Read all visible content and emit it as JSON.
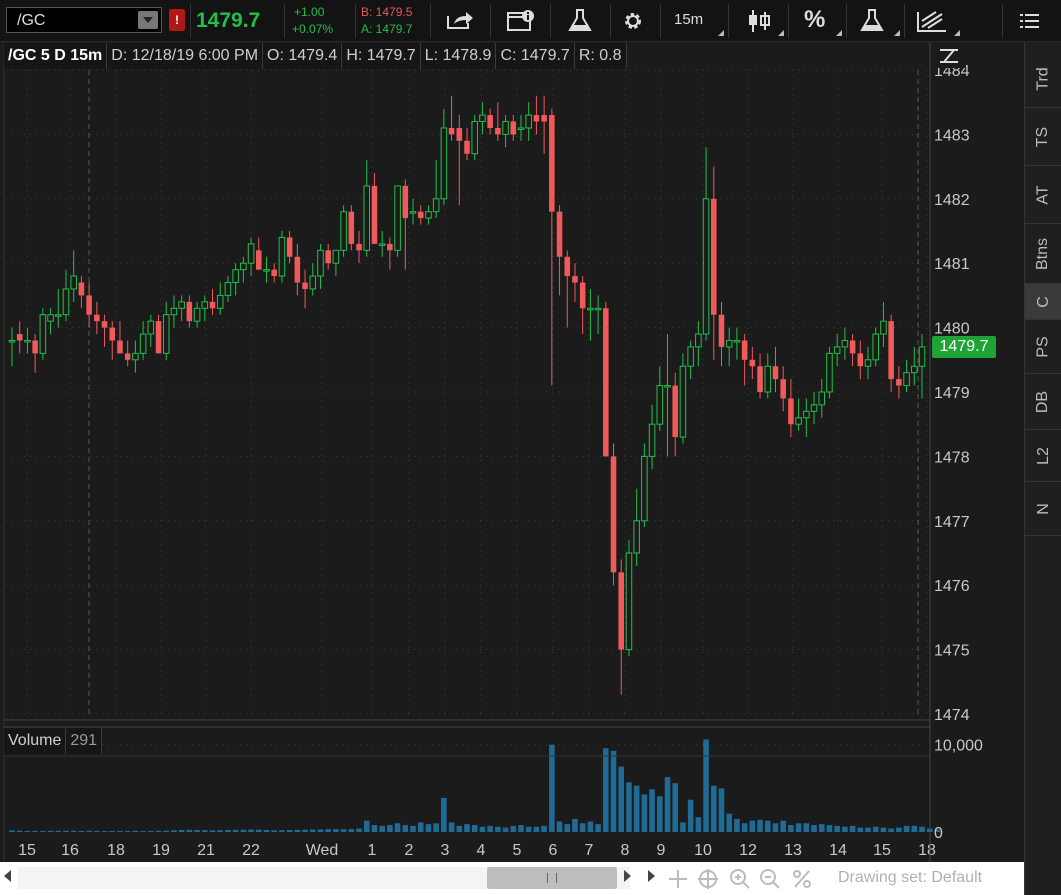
{
  "toolbar": {
    "symbol": "/GC",
    "alert_flag": "!",
    "last_price": "1479.7",
    "change_abs": "+1.00",
    "change_pct": "+0.07%",
    "bid": "B: 1479.5",
    "ask": "A: 1479.7",
    "interval": "15m",
    "percent": "%",
    "menu_icon": "hamburger-menu-icon"
  },
  "chart_header": {
    "title": "/GC 5 D 15m",
    "date": "D: 12/18/19 6:00 PM",
    "open": "O: 1479.4",
    "high": "H: 1479.7",
    "low": "L: 1478.9",
    "close": "C: 1479.7",
    "range": "R: 0.8"
  },
  "volume_header": {
    "label": "Volume",
    "value": "291"
  },
  "price_tag": "1479.7",
  "right_tabs": [
    "Trd",
    "TS",
    "AT",
    "Btns",
    "C",
    "PS",
    "DB",
    "L2",
    "N"
  ],
  "active_tab": "C",
  "bottom_bar": {
    "drawing_set": "Drawing set: Default"
  },
  "colors": {
    "up": "#21c04a",
    "down": "#f05a5a",
    "volume": "#1f6b95",
    "background": "#1b1b1b",
    "grid": "#3c3c3c"
  },
  "chart_data": {
    "type": "candlestick",
    "title": "/GC 5 D 15m",
    "ylim": [
      1474,
      1484
    ],
    "y_ticks": [
      "1484",
      "1483",
      "1482",
      "1481",
      "1480",
      "1479",
      "1478",
      "1477",
      "1476",
      "1475",
      "1474"
    ],
    "x_ticks": [
      "15",
      "16",
      "18",
      "19",
      "21",
      "22",
      "Wed",
      "1",
      "2",
      "3",
      "4",
      "5",
      "6",
      "7",
      "8",
      "9",
      "10",
      "12",
      "13",
      "14",
      "15",
      "18"
    ],
    "volume_ticks": [
      "10,000",
      "0"
    ],
    "volume_ylim": [
      0,
      11000
    ],
    "candles": [
      {
        "o": 1479.8,
        "h": 1480.0,
        "l": 1479.4,
        "c": 1479.8
      },
      {
        "o": 1479.9,
        "h": 1480.1,
        "l": 1479.6,
        "c": 1479.8
      },
      {
        "o": 1479.8,
        "h": 1480.0,
        "l": 1479.6,
        "c": 1479.8
      },
      {
        "o": 1479.8,
        "h": 1479.9,
        "l": 1479.3,
        "c": 1479.6
      },
      {
        "o": 1479.6,
        "h": 1480.3,
        "l": 1479.5,
        "c": 1480.2
      },
      {
        "o": 1480.1,
        "h": 1480.3,
        "l": 1479.9,
        "c": 1480.2
      },
      {
        "o": 1480.2,
        "h": 1480.6,
        "l": 1480.0,
        "c": 1480.2
      },
      {
        "o": 1480.2,
        "h": 1480.9,
        "l": 1480.1,
        "c": 1480.6
      },
      {
        "o": 1480.6,
        "h": 1481.2,
        "l": 1480.4,
        "c": 1480.8
      },
      {
        "o": 1480.7,
        "h": 1480.8,
        "l": 1480.3,
        "c": 1480.5
      },
      {
        "o": 1480.5,
        "h": 1480.7,
        "l": 1480.0,
        "c": 1480.2
      },
      {
        "o": 1480.2,
        "h": 1480.4,
        "l": 1479.9,
        "c": 1480.1
      },
      {
        "o": 1480.1,
        "h": 1480.2,
        "l": 1479.7,
        "c": 1480.0
      },
      {
        "o": 1480.0,
        "h": 1480.1,
        "l": 1479.5,
        "c": 1479.8
      },
      {
        "o": 1479.8,
        "h": 1480.1,
        "l": 1479.6,
        "c": 1479.6
      },
      {
        "o": 1479.6,
        "h": 1479.8,
        "l": 1479.4,
        "c": 1479.5
      },
      {
        "o": 1479.5,
        "h": 1479.8,
        "l": 1479.3,
        "c": 1479.6
      },
      {
        "o": 1479.6,
        "h": 1480.1,
        "l": 1479.5,
        "c": 1479.9
      },
      {
        "o": 1479.9,
        "h": 1480.2,
        "l": 1479.7,
        "c": 1480.1
      },
      {
        "o": 1480.1,
        "h": 1480.2,
        "l": 1479.6,
        "c": 1479.6
      },
      {
        "o": 1479.6,
        "h": 1480.4,
        "l": 1479.5,
        "c": 1480.2
      },
      {
        "o": 1480.2,
        "h": 1480.5,
        "l": 1480.0,
        "c": 1480.3
      },
      {
        "o": 1480.3,
        "h": 1480.5,
        "l": 1480.1,
        "c": 1480.4
      },
      {
        "o": 1480.4,
        "h": 1480.5,
        "l": 1480.0,
        "c": 1480.1
      },
      {
        "o": 1480.1,
        "h": 1480.4,
        "l": 1480.0,
        "c": 1480.3
      },
      {
        "o": 1480.3,
        "h": 1480.5,
        "l": 1480.1,
        "c": 1480.4
      },
      {
        "o": 1480.4,
        "h": 1480.6,
        "l": 1480.2,
        "c": 1480.3
      },
      {
        "o": 1480.3,
        "h": 1480.7,
        "l": 1480.2,
        "c": 1480.5
      },
      {
        "o": 1480.5,
        "h": 1480.8,
        "l": 1480.4,
        "c": 1480.7
      },
      {
        "o": 1480.7,
        "h": 1481.0,
        "l": 1480.5,
        "c": 1480.9
      },
      {
        "o": 1480.9,
        "h": 1481.1,
        "l": 1480.7,
        "c": 1481.0
      },
      {
        "o": 1481.0,
        "h": 1481.4,
        "l": 1480.8,
        "c": 1481.3
      },
      {
        "o": 1481.2,
        "h": 1481.4,
        "l": 1480.9,
        "c": 1480.9
      },
      {
        "o": 1480.9,
        "h": 1481.1,
        "l": 1480.7,
        "c": 1480.9
      },
      {
        "o": 1480.9,
        "h": 1481.0,
        "l": 1480.7,
        "c": 1480.8
      },
      {
        "o": 1480.8,
        "h": 1481.5,
        "l": 1480.7,
        "c": 1481.4
      },
      {
        "o": 1481.4,
        "h": 1481.5,
        "l": 1481.0,
        "c": 1481.1
      },
      {
        "o": 1481.1,
        "h": 1481.3,
        "l": 1480.5,
        "c": 1480.7
      },
      {
        "o": 1480.7,
        "h": 1480.9,
        "l": 1480.3,
        "c": 1480.6
      },
      {
        "o": 1480.6,
        "h": 1481.0,
        "l": 1480.5,
        "c": 1480.8
      },
      {
        "o": 1480.8,
        "h": 1481.3,
        "l": 1480.6,
        "c": 1481.2
      },
      {
        "o": 1481.2,
        "h": 1481.3,
        "l": 1480.9,
        "c": 1481.0
      },
      {
        "o": 1481.0,
        "h": 1481.2,
        "l": 1480.8,
        "c": 1481.2
      },
      {
        "o": 1481.2,
        "h": 1481.9,
        "l": 1481.1,
        "c": 1481.8
      },
      {
        "o": 1481.8,
        "h": 1481.9,
        "l": 1481.2,
        "c": 1481.3
      },
      {
        "o": 1481.3,
        "h": 1481.5,
        "l": 1481.0,
        "c": 1481.2
      },
      {
        "o": 1481.2,
        "h": 1482.6,
        "l": 1481.1,
        "c": 1482.2
      },
      {
        "o": 1482.2,
        "h": 1482.4,
        "l": 1481.3,
        "c": 1481.3
      },
      {
        "o": 1481.3,
        "h": 1481.5,
        "l": 1481.1,
        "c": 1481.3
      },
      {
        "o": 1481.3,
        "h": 1481.4,
        "l": 1480.9,
        "c": 1481.2
      },
      {
        "o": 1481.2,
        "h": 1482.2,
        "l": 1481.1,
        "c": 1482.2
      },
      {
        "o": 1482.2,
        "h": 1482.3,
        "l": 1480.9,
        "c": 1481.7
      },
      {
        "o": 1481.8,
        "h": 1482.0,
        "l": 1481.6,
        "c": 1481.8
      },
      {
        "o": 1481.8,
        "h": 1481.9,
        "l": 1481.6,
        "c": 1481.7
      },
      {
        "o": 1481.7,
        "h": 1481.9,
        "l": 1481.6,
        "c": 1481.8
      },
      {
        "o": 1481.8,
        "h": 1482.6,
        "l": 1481.7,
        "c": 1482.0
      },
      {
        "o": 1482.0,
        "h": 1483.4,
        "l": 1481.9,
        "c": 1483.1
      },
      {
        "o": 1483.1,
        "h": 1483.6,
        "l": 1482.9,
        "c": 1483.0
      },
      {
        "o": 1483.1,
        "h": 1483.3,
        "l": 1481.9,
        "c": 1482.9
      },
      {
        "o": 1482.9,
        "h": 1483.1,
        "l": 1482.6,
        "c": 1482.7
      },
      {
        "o": 1482.7,
        "h": 1483.3,
        "l": 1482.6,
        "c": 1483.2
      },
      {
        "o": 1483.2,
        "h": 1483.5,
        "l": 1483.0,
        "c": 1483.3
      },
      {
        "o": 1483.3,
        "h": 1483.4,
        "l": 1483.0,
        "c": 1483.1
      },
      {
        "o": 1483.1,
        "h": 1483.5,
        "l": 1482.9,
        "c": 1483.0
      },
      {
        "o": 1483.0,
        "h": 1483.3,
        "l": 1482.8,
        "c": 1483.2
      },
      {
        "o": 1483.2,
        "h": 1483.3,
        "l": 1482.9,
        "c": 1483.0
      },
      {
        "o": 1483.1,
        "h": 1483.3,
        "l": 1482.9,
        "c": 1483.1
      },
      {
        "o": 1483.1,
        "h": 1483.5,
        "l": 1482.9,
        "c": 1483.3
      },
      {
        "o": 1483.3,
        "h": 1483.6,
        "l": 1483.0,
        "c": 1483.2
      },
      {
        "o": 1483.3,
        "h": 1483.6,
        "l": 1482.7,
        "c": 1483.2
      },
      {
        "o": 1483.3,
        "h": 1483.4,
        "l": 1479.1,
        "c": 1481.8
      },
      {
        "o": 1481.8,
        "h": 1481.9,
        "l": 1480.5,
        "c": 1481.1
      },
      {
        "o": 1481.1,
        "h": 1481.2,
        "l": 1480.0,
        "c": 1480.8
      },
      {
        "o": 1480.8,
        "h": 1481.0,
        "l": 1480.4,
        "c": 1480.7
      },
      {
        "o": 1480.7,
        "h": 1480.8,
        "l": 1479.9,
        "c": 1480.3
      },
      {
        "o": 1480.3,
        "h": 1480.6,
        "l": 1479.8,
        "c": 1480.3
      },
      {
        "o": 1480.3,
        "h": 1480.5,
        "l": 1479.9,
        "c": 1480.3
      },
      {
        "o": 1480.3,
        "h": 1480.4,
        "l": 1478.0,
        "c": 1478.0
      },
      {
        "o": 1478.0,
        "h": 1478.2,
        "l": 1476.0,
        "c": 1476.2
      },
      {
        "o": 1476.2,
        "h": 1476.4,
        "l": 1474.3,
        "c": 1475.0
      },
      {
        "o": 1475.0,
        "h": 1476.7,
        "l": 1474.9,
        "c": 1476.5
      },
      {
        "o": 1476.5,
        "h": 1477.5,
        "l": 1476.3,
        "c": 1477.0
      },
      {
        "o": 1477.0,
        "h": 1478.2,
        "l": 1476.9,
        "c": 1478.0
      },
      {
        "o": 1478.0,
        "h": 1478.8,
        "l": 1477.8,
        "c": 1478.5
      },
      {
        "o": 1478.5,
        "h": 1479.4,
        "l": 1478.4,
        "c": 1479.1
      },
      {
        "o": 1479.1,
        "h": 1479.9,
        "l": 1478.0,
        "c": 1479.1
      },
      {
        "o": 1479.1,
        "h": 1479.3,
        "l": 1478.0,
        "c": 1478.3
      },
      {
        "o": 1478.3,
        "h": 1479.6,
        "l": 1478.2,
        "c": 1479.4
      },
      {
        "o": 1479.4,
        "h": 1479.8,
        "l": 1479.2,
        "c": 1479.7
      },
      {
        "o": 1479.7,
        "h": 1480.1,
        "l": 1479.4,
        "c": 1479.9
      },
      {
        "o": 1479.9,
        "h": 1482.8,
        "l": 1479.8,
        "c": 1482.0
      },
      {
        "o": 1482.0,
        "h": 1482.5,
        "l": 1479.5,
        "c": 1480.2
      },
      {
        "o": 1480.2,
        "h": 1480.4,
        "l": 1479.4,
        "c": 1479.7
      },
      {
        "o": 1479.7,
        "h": 1480.0,
        "l": 1479.4,
        "c": 1479.8
      },
      {
        "o": 1479.8,
        "h": 1480.0,
        "l": 1479.5,
        "c": 1479.8
      },
      {
        "o": 1479.8,
        "h": 1479.9,
        "l": 1479.1,
        "c": 1479.5
      },
      {
        "o": 1479.5,
        "h": 1479.7,
        "l": 1479.2,
        "c": 1479.4
      },
      {
        "o": 1479.4,
        "h": 1479.6,
        "l": 1478.9,
        "c": 1479.0
      },
      {
        "o": 1479.0,
        "h": 1479.6,
        "l": 1478.9,
        "c": 1479.4
      },
      {
        "o": 1479.4,
        "h": 1479.7,
        "l": 1479.0,
        "c": 1479.2
      },
      {
        "o": 1479.2,
        "h": 1479.4,
        "l": 1478.7,
        "c": 1478.9
      },
      {
        "o": 1478.9,
        "h": 1479.2,
        "l": 1478.3,
        "c": 1478.5
      },
      {
        "o": 1478.5,
        "h": 1478.9,
        "l": 1478.4,
        "c": 1478.6
      },
      {
        "o": 1478.6,
        "h": 1478.9,
        "l": 1478.3,
        "c": 1478.7
      },
      {
        "o": 1478.7,
        "h": 1479.0,
        "l": 1478.5,
        "c": 1478.8
      },
      {
        "o": 1478.8,
        "h": 1479.2,
        "l": 1478.6,
        "c": 1479.0
      },
      {
        "o": 1479.0,
        "h": 1479.7,
        "l": 1478.9,
        "c": 1479.6
      },
      {
        "o": 1479.6,
        "h": 1479.9,
        "l": 1479.4,
        "c": 1479.7
      },
      {
        "o": 1479.7,
        "h": 1480.0,
        "l": 1479.5,
        "c": 1479.8
      },
      {
        "o": 1479.8,
        "h": 1479.9,
        "l": 1479.4,
        "c": 1479.6
      },
      {
        "o": 1479.6,
        "h": 1479.8,
        "l": 1479.2,
        "c": 1479.4
      },
      {
        "o": 1479.4,
        "h": 1479.7,
        "l": 1479.2,
        "c": 1479.5
      },
      {
        "o": 1479.5,
        "h": 1480.0,
        "l": 1479.4,
        "c": 1479.9
      },
      {
        "o": 1479.9,
        "h": 1480.4,
        "l": 1479.7,
        "c": 1480.1
      },
      {
        "o": 1480.1,
        "h": 1480.2,
        "l": 1479.0,
        "c": 1479.2
      },
      {
        "o": 1479.2,
        "h": 1479.4,
        "l": 1478.9,
        "c": 1479.1
      },
      {
        "o": 1479.1,
        "h": 1479.5,
        "l": 1479.0,
        "c": 1479.3
      },
      {
        "o": 1479.3,
        "h": 1479.7,
        "l": 1479.1,
        "c": 1479.4
      },
      {
        "o": 1479.4,
        "h": 1479.9,
        "l": 1478.9,
        "c": 1479.7
      }
    ],
    "volume": [
      200,
      150,
      120,
      130,
      110,
      130,
      140,
      150,
      150,
      120,
      140,
      120,
      110,
      120,
      110,
      120,
      130,
      110,
      120,
      140,
      160,
      200,
      230,
      250,
      220,
      210,
      200,
      210,
      230,
      250,
      260,
      270,
      260,
      240,
      200,
      210,
      230,
      240,
      260,
      280,
      300,
      320,
      340,
      320,
      340,
      400,
      1300,
      800,
      700,
      800,
      1000,
      800,
      700,
      1100,
      900,
      1000,
      3900,
      1100,
      700,
      900,
      800,
      600,
      700,
      600,
      500,
      700,
      800,
      600,
      600,
      700,
      10000,
      1200,
      900,
      1500,
      1000,
      1200,
      900,
      9600,
      9300,
      7500,
      5700,
      5300,
      4300,
      4900,
      4100,
      6300,
      5600,
      1100,
      3700,
      1700,
      10600,
      5300,
      5000,
      2100,
      1500,
      1000,
      1300,
      1400,
      1300,
      1000,
      1300,
      800,
      1000,
      1000,
      800,
      900,
      800,
      700,
      600,
      700,
      500,
      500,
      600,
      500,
      400,
      500,
      700,
      700,
      600,
      400,
      300
    ]
  }
}
